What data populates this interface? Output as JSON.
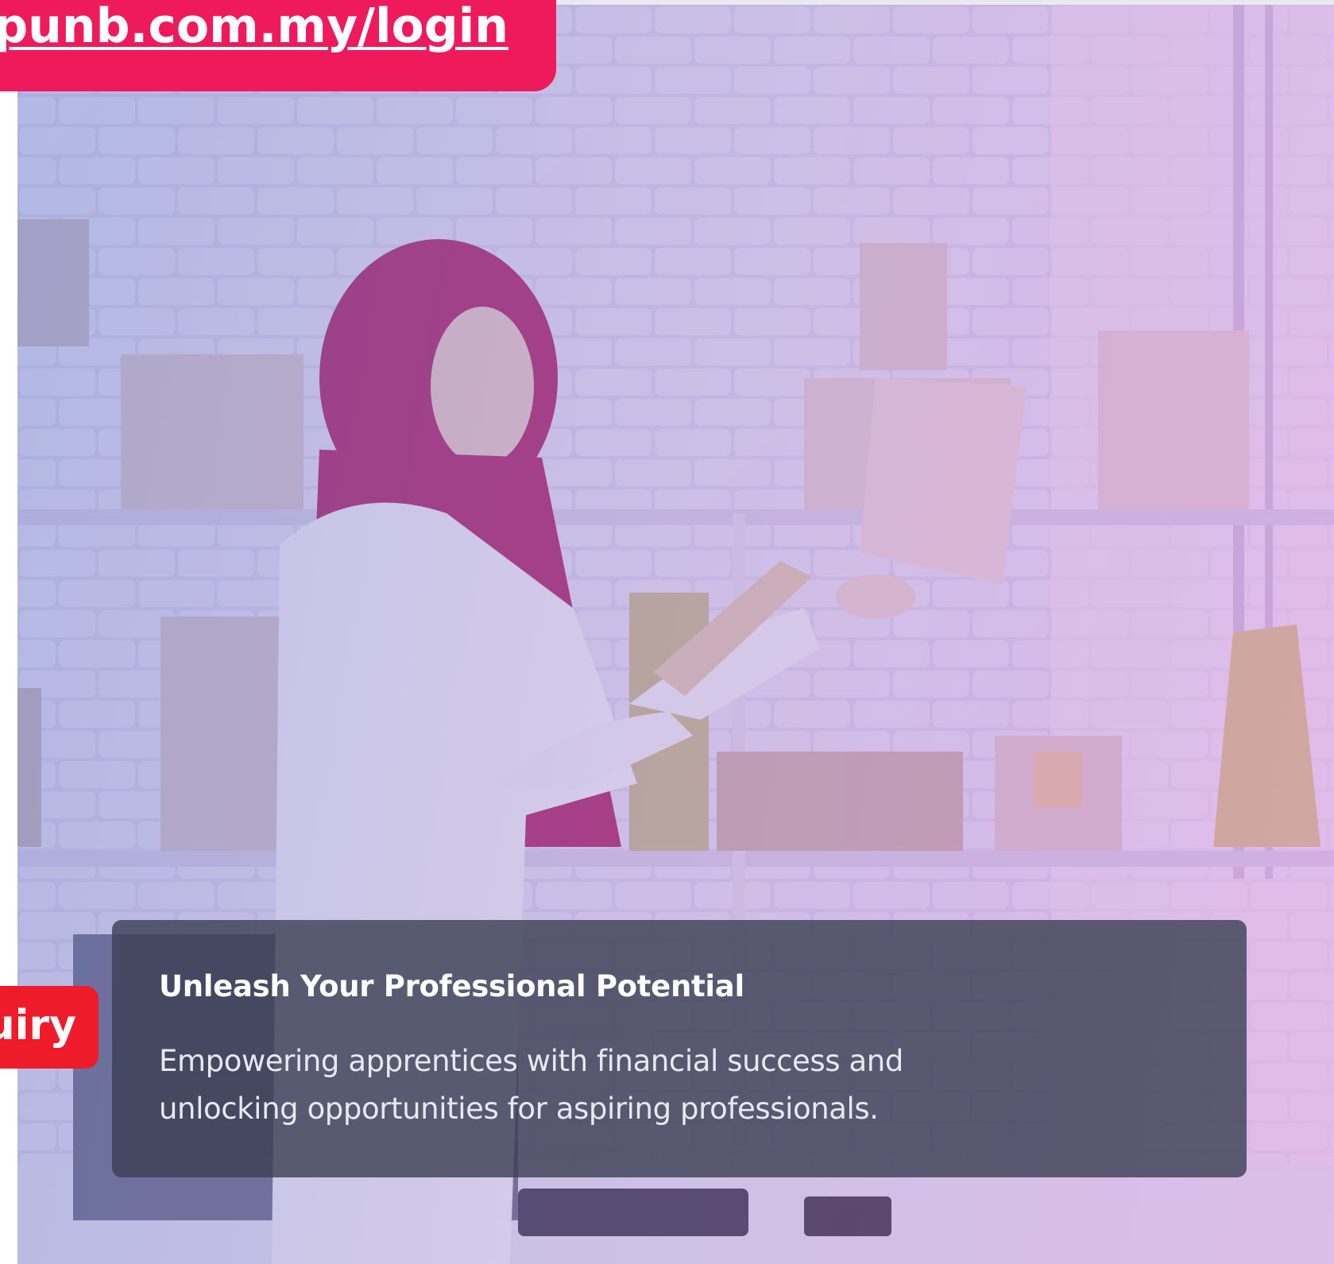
{
  "banner": {
    "url_text": "rtal.punb.com.my/login",
    "background_color": "#ee1a5c"
  },
  "enquiry_tab": {
    "label": "uiry",
    "background_color": "#ee1c2a"
  },
  "hero": {
    "overlay_colors": [
      "#5f73c8",
      "#c864d2"
    ]
  },
  "caption": {
    "title": "Unleash Your Professional Potential",
    "body": "Empowering apprentices with financial success and unlocking opportunities for aspiring professionals."
  }
}
